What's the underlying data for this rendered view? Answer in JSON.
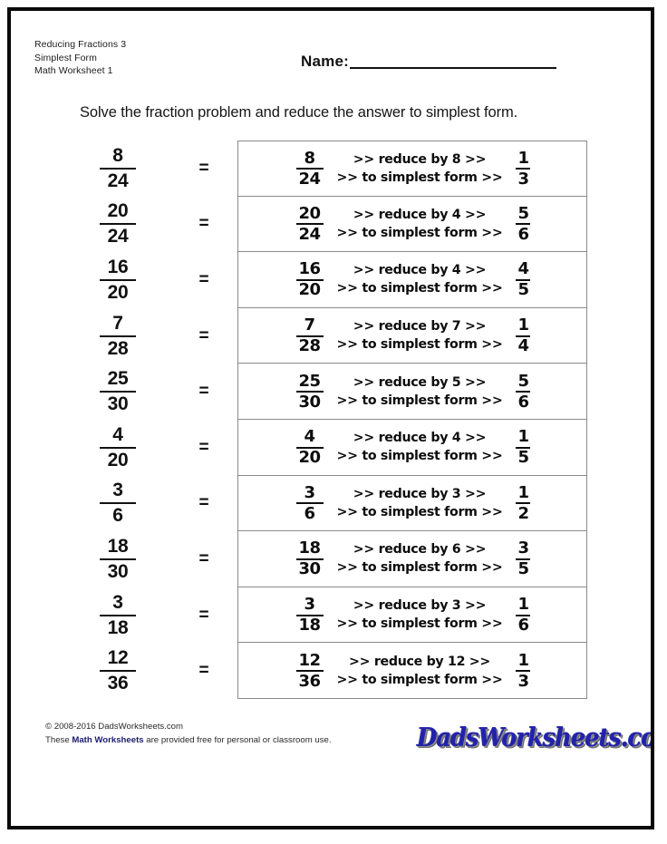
{
  "header": {
    "lines": [
      "Reducing Fractions 3",
      "Simplest Form",
      "Math Worksheet 1"
    ],
    "name_label": "Name:"
  },
  "instruction": "Solve the fraction problem and reduce the answer to simplest form.",
  "problems": [
    {
      "left": {
        "numerator": "8",
        "denominator": "24"
      },
      "equals": "=",
      "source": {
        "numerator": "8",
        "denominator": "24"
      },
      "step_1": ">> reduce by 8 >>",
      "step_2": ">> to simplest form >>",
      "result": {
        "numerator": "1",
        "denominator": "3"
      }
    },
    {
      "left": {
        "numerator": "20",
        "denominator": "24"
      },
      "equals": "=",
      "source": {
        "numerator": "20",
        "denominator": "24"
      },
      "step_1": ">> reduce by 4 >>",
      "step_2": ">> to simplest form >>",
      "result": {
        "numerator": "5",
        "denominator": "6"
      }
    },
    {
      "left": {
        "numerator": "16",
        "denominator": "20"
      },
      "equals": "=",
      "source": {
        "numerator": "16",
        "denominator": "20"
      },
      "step_1": ">> reduce by 4 >>",
      "step_2": ">> to simplest form >>",
      "result": {
        "numerator": "4",
        "denominator": "5"
      }
    },
    {
      "left": {
        "numerator": "7",
        "denominator": "28"
      },
      "equals": "=",
      "source": {
        "numerator": "7",
        "denominator": "28"
      },
      "step_1": ">> reduce by 7 >>",
      "step_2": ">> to simplest form >>",
      "result": {
        "numerator": "1",
        "denominator": "4"
      }
    },
    {
      "left": {
        "numerator": "25",
        "denominator": "30"
      },
      "equals": "=",
      "source": {
        "numerator": "25",
        "denominator": "30"
      },
      "step_1": ">> reduce by 5 >>",
      "step_2": ">> to simplest form >>",
      "result": {
        "numerator": "5",
        "denominator": "6"
      }
    },
    {
      "left": {
        "numerator": "4",
        "denominator": "20"
      },
      "equals": "=",
      "source": {
        "numerator": "4",
        "denominator": "20"
      },
      "step_1": ">> reduce by 4 >>",
      "step_2": ">> to simplest form >>",
      "result": {
        "numerator": "1",
        "denominator": "5"
      }
    },
    {
      "left": {
        "numerator": "3",
        "denominator": "6"
      },
      "equals": "=",
      "source": {
        "numerator": "3",
        "denominator": "6"
      },
      "step_1": ">> reduce by 3 >>",
      "step_2": ">> to simplest form >>",
      "result": {
        "numerator": "1",
        "denominator": "2"
      }
    },
    {
      "left": {
        "numerator": "18",
        "denominator": "30"
      },
      "equals": "=",
      "source": {
        "numerator": "18",
        "denominator": "30"
      },
      "step_1": ">> reduce by 6 >>",
      "step_2": ">> to simplest form >>",
      "result": {
        "numerator": "3",
        "denominator": "5"
      }
    },
    {
      "left": {
        "numerator": "3",
        "denominator": "18"
      },
      "equals": "=",
      "source": {
        "numerator": "3",
        "denominator": "18"
      },
      "step_1": ">> reduce by 3 >>",
      "step_2": ">> to simplest form >>",
      "result": {
        "numerator": "1",
        "denominator": "6"
      }
    },
    {
      "left": {
        "numerator": "12",
        "denominator": "36"
      },
      "equals": "=",
      "source": {
        "numerator": "12",
        "denominator": "36"
      },
      "step_1": ">> reduce by 12 >>",
      "step_2": ">> to simplest form >>",
      "result": {
        "numerator": "1",
        "denominator": "3"
      }
    }
  ],
  "footer": {
    "copyright": "© 2008-2016 DadsWorksheets.com",
    "usage_prefix": "These",
    "usage_link": "Math Worksheets",
    "usage_suffix": "are provided free for personal or classroom use.",
    "logo_text": "DadsWorksheets.com",
    "logo_color": "#2222aa",
    "link_color": "#1a1a6e"
  }
}
